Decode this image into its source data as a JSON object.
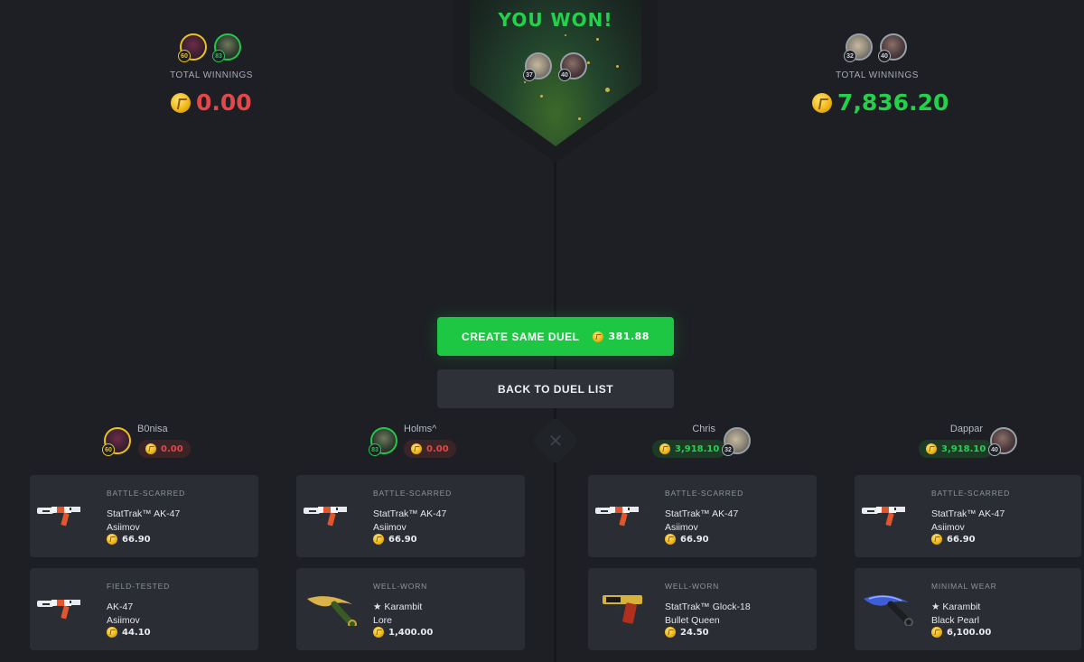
{
  "header": {
    "result_text": "YOU WON!",
    "winner_levels": [
      "37",
      "40"
    ],
    "left_team": {
      "levels": [
        "60",
        "83"
      ],
      "total_label": "TOTAL WINNINGS",
      "total_amount": "0.00"
    },
    "right_team": {
      "levels": [
        "32",
        "40"
      ],
      "total_label": "TOTAL WINNINGS",
      "total_amount": "7,836.20"
    }
  },
  "actions": {
    "create_label": "CREATE SAME DUEL",
    "create_price": "381.88",
    "back_label": "BACK TO DUEL LIST"
  },
  "players": [
    {
      "name": "B0nisa",
      "level": "60",
      "winnings": "0.00",
      "items": [
        {
          "condition": "BATTLE-SCARRED",
          "name": "StatTrak™ AK-47",
          "skin": "Asiimov",
          "price": "66.90"
        },
        {
          "condition": "FIELD-TESTED",
          "name": "AK-47",
          "skin": "Asiimov",
          "price": "44.10"
        }
      ]
    },
    {
      "name": "Holms^",
      "level": "83",
      "winnings": "0.00",
      "items": [
        {
          "condition": "BATTLE-SCARRED",
          "name": "StatTrak™ AK-47",
          "skin": "Asiimov",
          "price": "66.90"
        },
        {
          "condition": "WELL-WORN",
          "name": "★ Karambit",
          "skin": "Lore",
          "price": "1,400.00"
        }
      ]
    },
    {
      "name": "Chris",
      "level": "32",
      "winnings": "3,918.10",
      "items": [
        {
          "condition": "BATTLE-SCARRED",
          "name": "StatTrak™ AK-47",
          "skin": "Asiimov",
          "price": "66.90"
        },
        {
          "condition": "WELL-WORN",
          "name": "StatTrak™ Glock-18",
          "skin": "Bullet Queen",
          "price": "24.50"
        }
      ]
    },
    {
      "name": "Dappar",
      "level": "40",
      "winnings": "3,918.10",
      "items": [
        {
          "condition": "BATTLE-SCARRED",
          "name": "StatTrak™ AK-47",
          "skin": "Asiimov",
          "price": "66.90"
        },
        {
          "condition": "MINIMAL WEAR",
          "name": "★ Karambit",
          "skin": "Black Pearl",
          "price": "6,100.00"
        }
      ]
    }
  ],
  "colors": {
    "win_green": "#22d24b",
    "loss_red": "#e4474a",
    "coin_gold": "#f0b818"
  }
}
